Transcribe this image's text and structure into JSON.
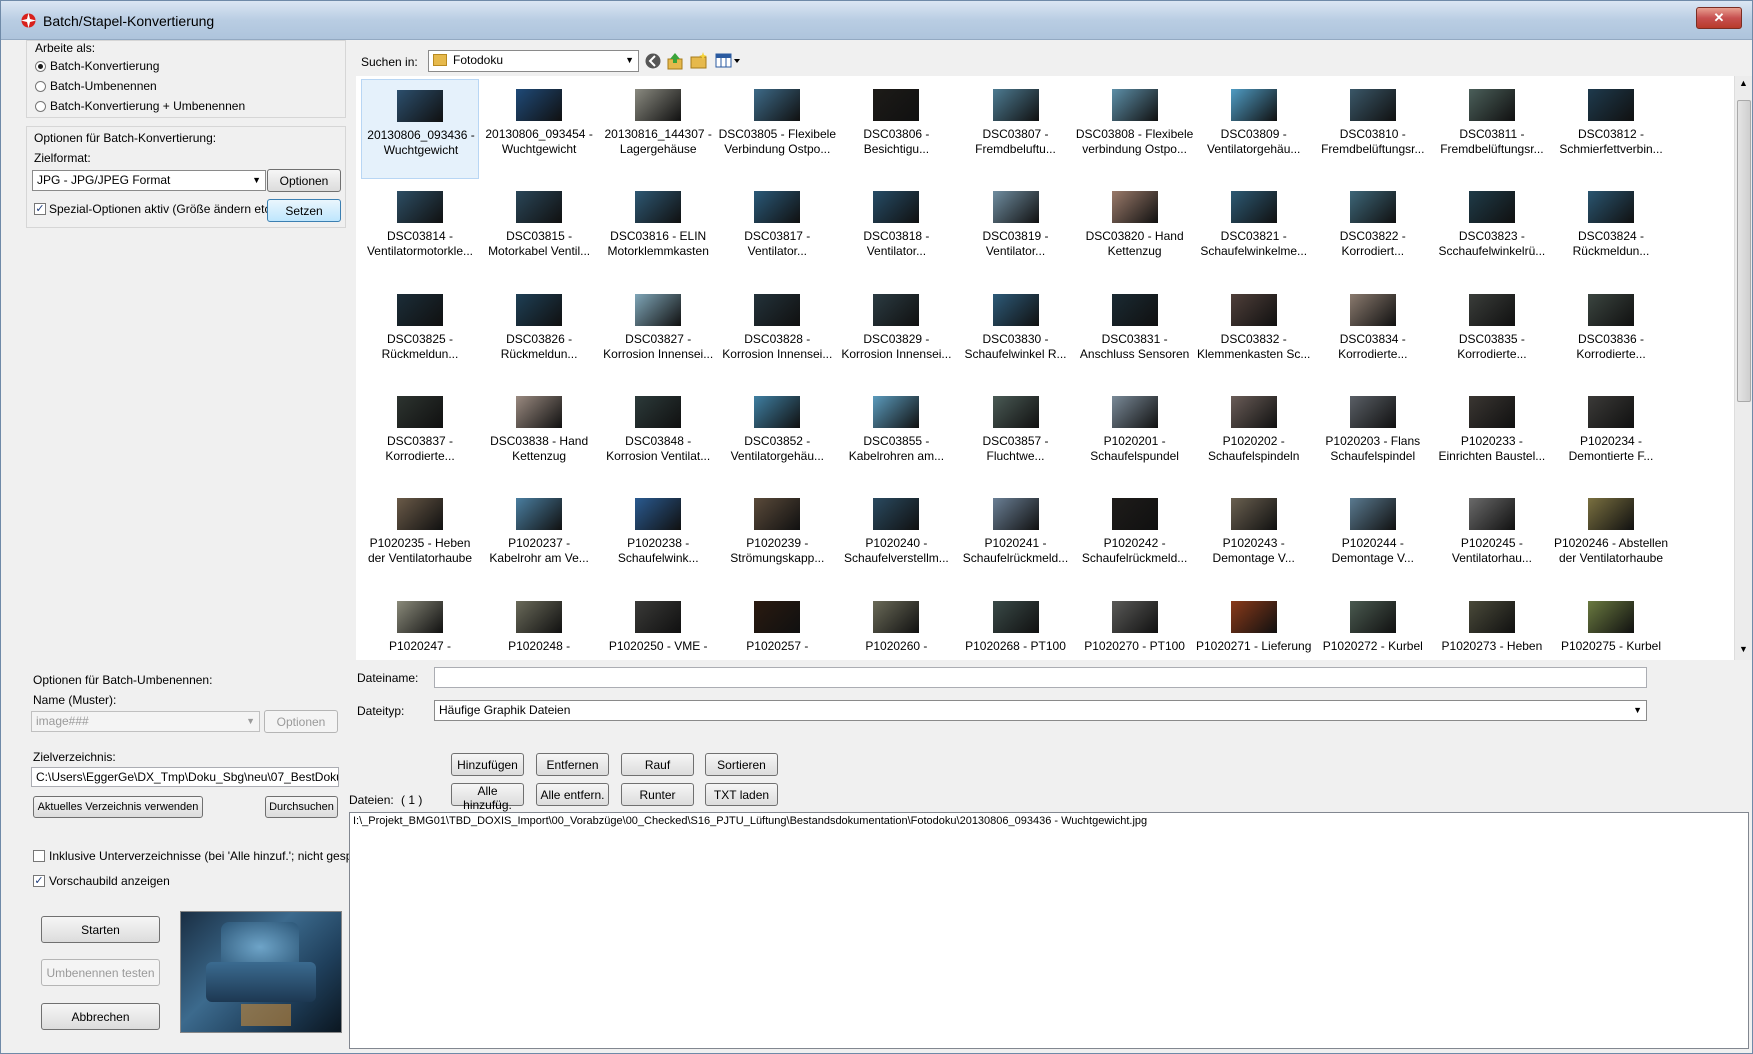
{
  "window": {
    "title": "Batch/Stapel-Konvertierung",
    "close_label": "✕"
  },
  "work_mode": {
    "group_label": "Arbeite als:",
    "options": [
      "Batch-Konvertierung",
      "Batch-Umbenennen",
      "Batch-Konvertierung + Umbenennen"
    ],
    "selected_index": 0
  },
  "convert_options": {
    "group_label": "Optionen für Batch-Konvertierung:",
    "target_format_label": "Zielformat:",
    "target_format_value": "JPG - JPG/JPEG Format",
    "options_button": "Optionen",
    "special_options_label": "Spezial-Optionen aktiv (Größe ändern etc.)",
    "special_options_checked": true,
    "set_button": "Setzen"
  },
  "rename_options": {
    "group_label": "Optionen für Batch-Umbenennen:",
    "name_label": "Name (Muster):",
    "name_value": "image###",
    "options_button": "Optionen"
  },
  "target_dir": {
    "label": "Zielverzeichnis:",
    "value": "C:\\Users\\EggerGe\\DX_Tmp\\Doku_Sbg\\neu\\07_BestDoku\\",
    "use_current_button": "Aktuelles Verzeichnis verwenden",
    "browse_button": "Durchsuchen"
  },
  "include_subdirs": {
    "label": "Inklusive Unterverzeichnisse (bei 'Alle hinzuf.'; nicht gesp.)",
    "checked": false
  },
  "show_preview": {
    "label": "Vorschaubild anzeigen",
    "checked": true
  },
  "actions": {
    "start": "Starten",
    "test_rename": "Umbenennen testen",
    "cancel": "Abbrechen"
  },
  "browser": {
    "search_in_label": "Suchen in:",
    "folder_value": "Fotodoku",
    "thumbnails": [
      {
        "l1": "20130806_093436 -",
        "l2": "Wuchtgewicht",
        "c": "#2c4f6d"
      },
      {
        "l1": "20130806_093454 -",
        "l2": "Wuchtgewicht",
        "c": "#1f4a78"
      },
      {
        "l1": "20130816_144307 -",
        "l2": "Lagergehäuse",
        "c": "#8a8a80"
      },
      {
        "l1": "DSC03805 - Flexibele",
        "l2": "Verbindung Ostpo...",
        "c": "#3d6a88"
      },
      {
        "l1": "DSC03806 -",
        "l2": "Besichtigu...",
        "c": "#1d1b18"
      },
      {
        "l1": "DSC03807 -",
        "l2": "Fremdbeluftu...",
        "c": "#4d7b92"
      },
      {
        "l1": "DSC03808 - Flexibele",
        "l2": "verbindung Ostpo...",
        "c": "#5d8fa8"
      },
      {
        "l1": "DSC03809 -",
        "l2": "Ventilatorgehäu...",
        "c": "#4f9cc4"
      },
      {
        "l1": "DSC03810 -",
        "l2": "Fremdbelüftungsr...",
        "c": "#3a5768"
      },
      {
        "l1": "DSC03811 -",
        "l2": "Fremdbelüftungsr...",
        "c": "#4b5f5a"
      },
      {
        "l1": "DSC03812 -",
        "l2": "Schmierfettverbin...",
        "c": "#1e3a4d"
      },
      {
        "l1": "DSC03814 -",
        "l2": "Ventilatormotorkle...",
        "c": "#2d4e64"
      },
      {
        "l1": "DSC03815 -",
        "l2": "Motorkabel Ventil...",
        "c": "#2a4658"
      },
      {
        "l1": "DSC03816 - ELIN",
        "l2": "Motorklemmkasten",
        "c": "#2e5873"
      },
      {
        "l1": "DSC03817 -",
        "l2": "Ventilator...",
        "c": "#2a5978"
      },
      {
        "l1": "DSC03818 -",
        "l2": "Ventilator...",
        "c": "#264c66"
      },
      {
        "l1": "DSC03819 -",
        "l2": "Ventilator...",
        "c": "#6f8da0"
      },
      {
        "l1": "DSC03820 - Hand",
        "l2": "Kettenzug",
        "c": "#9a7a6a"
      },
      {
        "l1": "DSC03821 -",
        "l2": "Schaufelwinkelme...",
        "c": "#2d5a74"
      },
      {
        "l1": "DSC03822 -",
        "l2": "Korrodiert...",
        "c": "#3d6678"
      },
      {
        "l1": "DSC03823 -",
        "l2": "Scchaufelwinkelrü...",
        "c": "#1f3b48"
      },
      {
        "l1": "DSC03824 -",
        "l2": "Rückmeldun...",
        "c": "#2a5570"
      },
      {
        "l1": "DSC03825 -",
        "l2": "Rückmeldun...",
        "c": "#1b2d38"
      },
      {
        "l1": "DSC03826 -",
        "l2": "Rückmeldun...",
        "c": "#1e3f55"
      },
      {
        "l1": "DSC03827 -",
        "l2": "Korrosion Innensei...",
        "c": "#7fa6b8"
      },
      {
        "l1": "DSC03828 -",
        "l2": "Korrosion Innensei...",
        "c": "#23323a"
      },
      {
        "l1": "DSC03829 -",
        "l2": "Korrosion Innensei...",
        "c": "#2b3b42"
      },
      {
        "l1": "DSC03830 -",
        "l2": "Schaufelwinkel R...",
        "c": "#2d5a78"
      },
      {
        "l1": "DSC03831 -",
        "l2": "Anschluss Sensoren",
        "c": "#1a2a33"
      },
      {
        "l1": "DSC03832 -",
        "l2": "Klemmenkasten Sc...",
        "c": "#4f3f3a"
      },
      {
        "l1": "DSC03834 -",
        "l2": "Korrodierte...",
        "c": "#8a7a6e"
      },
      {
        "l1": "DSC03835 -",
        "l2": "Korrodierte...",
        "c": "#3a3d3a"
      },
      {
        "l1": "DSC03836 -",
        "l2": "Korrodierte...",
        "c": "#3b4540"
      },
      {
        "l1": "DSC03837 -",
        "l2": "Korrodierte...",
        "c": "#2d3430"
      },
      {
        "l1": "DSC03838 - Hand",
        "l2": "Kettenzug",
        "c": "#9a8a80"
      },
      {
        "l1": "DSC03848 -",
        "l2": "Korrosion Ventilat...",
        "c": "#2c3a3a"
      },
      {
        "l1": "DSC03852 -",
        "l2": "Ventilatorgehäu...",
        "c": "#3f7fa2"
      },
      {
        "l1": "DSC03855 -",
        "l2": "Kabelrohren am...",
        "c": "#5b9bbd"
      },
      {
        "l1": "DSC03857 -",
        "l2": "Fluchtwe...",
        "c": "#4a5a55"
      },
      {
        "l1": "P1020201 -",
        "l2": "Schaufelspundel",
        "c": "#7a8a98"
      },
      {
        "l1": "P1020202 -",
        "l2": "Schaufelspindeln",
        "c": "#6a5d58"
      },
      {
        "l1": "P1020203 - Flans",
        "l2": "Schaufelspindel",
        "c": "#5a5f66"
      },
      {
        "l1": "P1020233 -",
        "l2": "Einrichten Baustel...",
        "c": "#3a3632"
      },
      {
        "l1": "P1020234 -",
        "l2": "Demontierte F...",
        "c": "#3b3a38"
      },
      {
        "l1": "P1020235 - Heben",
        "l2": "der Ventilatorhaube",
        "c": "#6a5a48"
      },
      {
        "l1": "P1020237 -",
        "l2": "Kabelrohr am Ve...",
        "c": "#4a7ea0"
      },
      {
        "l1": "P1020238 -",
        "l2": "Schaufelwink...",
        "c": "#2a5a90"
      },
      {
        "l1": "P1020239 -",
        "l2": "Strömungskapp...",
        "c": "#5a4a3a"
      },
      {
        "l1": "P1020240 -",
        "l2": "Schaufelverstellm...",
        "c": "#2a4a60"
      },
      {
        "l1": "P1020241 -",
        "l2": "Schaufelrückmeld...",
        "c": "#6a7f95"
      },
      {
        "l1": "P1020242 -",
        "l2": "Schaufelrückmeld...",
        "c": "#1e1c1a"
      },
      {
        "l1": "P1020243 -",
        "l2": "Demontage V...",
        "c": "#6a6050"
      },
      {
        "l1": "P1020244 -",
        "l2": "Demontage V...",
        "c": "#5a7a90"
      },
      {
        "l1": "P1020245 -",
        "l2": "Ventilatorhau...",
        "c": "#6a6a6a"
      },
      {
        "l1": "P1020246 - Abstellen",
        "l2": "der Ventilatorhaube",
        "c": "#7a7040"
      },
      {
        "l1": "P1020247 -",
        "l2": "",
        "c": "#8a8a7a"
      },
      {
        "l1": "P1020248 -",
        "l2": "",
        "c": "#6a6a5a"
      },
      {
        "l1": "P1020250 - VME -",
        "l2": "",
        "c": "#3a3a38"
      },
      {
        "l1": "P1020257 -",
        "l2": "",
        "c": "#2a1a10"
      },
      {
        "l1": "P1020260 -",
        "l2": "",
        "c": "#6a6a58"
      },
      {
        "l1": "P1020268 - PT100",
        "l2": "",
        "c": "#3a4a48"
      },
      {
        "l1": "P1020270 - PT100",
        "l2": "",
        "c": "#5a5a58"
      },
      {
        "l1": "P1020271 - Lieferung",
        "l2": "",
        "c": "#8a3a1a"
      },
      {
        "l1": "P1020272 - Kurbel",
        "l2": "",
        "c": "#4a5a50"
      },
      {
        "l1": "P1020273 - Heben",
        "l2": "",
        "c": "#4a4a3a"
      },
      {
        "l1": "P1020275 - Kurbel",
        "l2": "",
        "c": "#6a7a40"
      }
    ]
  },
  "file_fields": {
    "filename_label": "Dateiname:",
    "filename_value": "",
    "filetype_label": "Dateityp:",
    "filetype_value": "Häufige Graphik Dateien"
  },
  "list_buttons": {
    "add": "Hinzufügen",
    "remove": "Entfernen",
    "up": "Rauf",
    "sort": "Sortieren",
    "add_all": "Alle hinzufüg.",
    "remove_all": "Alle entfern.",
    "down": "Runter",
    "load_txt": "TXT laden"
  },
  "files_list": {
    "label": "Dateien:",
    "count": "( 1 )",
    "items": [
      "I:\\_Projekt_BMG01\\TBD_DOXIS_Import\\00_Vorabzüge\\00_Checked\\S16_PJTU_Lüftung\\Bestandsdokumentation\\Fotodoku\\20130806_093436 - Wuchtgewicht.jpg"
    ]
  }
}
